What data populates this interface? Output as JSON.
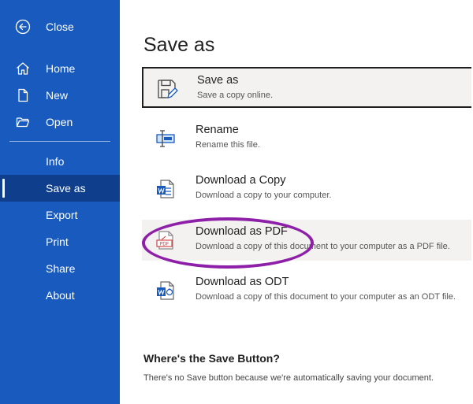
{
  "sidebar": {
    "close_label": "Close",
    "items": [
      {
        "label": "Home",
        "icon": "home-icon"
      },
      {
        "label": "New",
        "icon": "document-icon"
      },
      {
        "label": "Open",
        "icon": "folder-icon"
      },
      {
        "label": "Info"
      },
      {
        "label": "Save as",
        "active": true
      },
      {
        "label": "Export"
      },
      {
        "label": "Print"
      },
      {
        "label": "Share"
      },
      {
        "label": "About"
      }
    ]
  },
  "main": {
    "title": "Save as",
    "options": [
      {
        "title": "Save as",
        "desc": "Save a copy online.",
        "icon": "save-as-icon",
        "state": "selected"
      },
      {
        "title": "Rename",
        "desc": "Rename this file.",
        "icon": "rename-icon"
      },
      {
        "title": "Download a Copy",
        "desc": "Download a copy to your computer.",
        "icon": "word-document-icon"
      },
      {
        "title": "Download as PDF",
        "desc": "Download a copy of this document to your computer as a PDF file.",
        "icon": "pdf-icon",
        "state": "hover",
        "highlighted": true
      },
      {
        "title": "Download as ODT",
        "desc": "Download a copy of this document to your computer as an ODT file.",
        "icon": "odt-icon"
      }
    ],
    "save_button_section": {
      "title": "Where's the Save Button?",
      "text": "There's no Save button because we're automatically saving your document."
    }
  },
  "colors": {
    "sidebar_bg": "#185abd",
    "sidebar_active": "#0f3f8c",
    "highlight_ring": "#8e1fa8",
    "word_blue": "#185abd",
    "pdf_red": "#d13438"
  }
}
